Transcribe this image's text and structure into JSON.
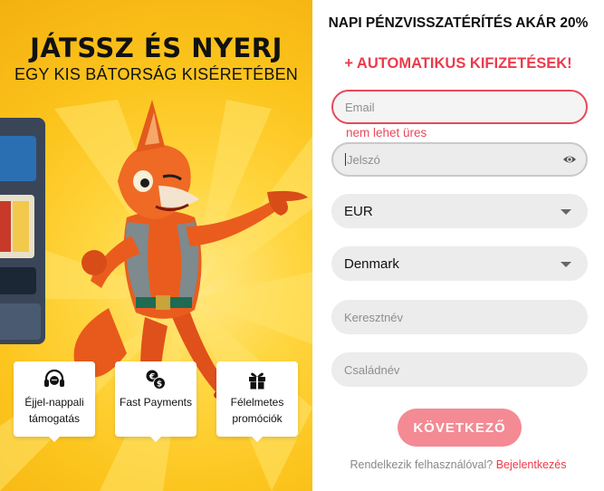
{
  "promo": {
    "headline": "JÁTSSZ ÉS NYERJ",
    "subheadline": "EGY KIS BÁTORSÁG KISÉRETÉBEN",
    "features": [
      {
        "icon": "headset-icon",
        "label": "Éjjel-nappali támogatás"
      },
      {
        "icon": "money-exchange-icon",
        "label": "Fast Payments"
      },
      {
        "icon": "gift-icon",
        "label": "Félelmetes promóciók"
      }
    ]
  },
  "form": {
    "title": "NAPI PÉNZVISSZATÉRÍTÉS AKÁR 20%",
    "subtitle": "+ AUTOMATIKUS KIFIZETÉSEK!",
    "email_placeholder": "Email",
    "email_error": "nem lehet üres",
    "password_placeholder": "Jelszó",
    "currency_value": "EUR",
    "country_value": "Denmark",
    "first_name_placeholder": "Keresztnév",
    "last_name_placeholder": "Családnév",
    "submit_label": "KÖVETKEZŐ",
    "footer_text": "Rendelkezik felhasználóval?",
    "footer_link": "Bejelentkezés"
  },
  "colors": {
    "accent": "#ec3a4c",
    "button": "#f48a94",
    "promo_bg": "#fcc51e"
  }
}
